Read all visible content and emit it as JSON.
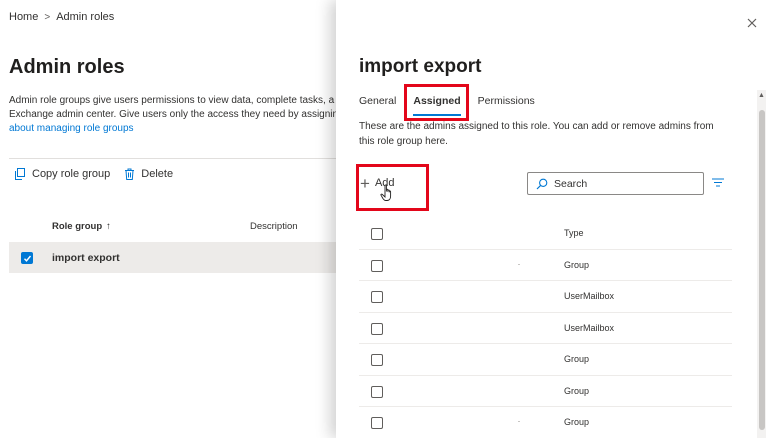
{
  "breadcrumb": {
    "home": "Home",
    "separator": ">",
    "current": "Admin roles"
  },
  "page": {
    "title": "Admin roles",
    "description_line1": "Admin role groups give users permissions to view data, complete tasks, a",
    "description_line2": "Exchange admin center. Give users only the access they need by assignin",
    "description_link": "about managing role groups"
  },
  "commands": {
    "copy": "Copy role group",
    "delete": "Delete"
  },
  "list": {
    "col_role": "Role group",
    "sort_indicator": "↑",
    "col_description": "Description",
    "selected_row": "import export"
  },
  "panel": {
    "title": "import export",
    "tabs": [
      {
        "label": "General"
      },
      {
        "label": "Assigned"
      },
      {
        "label": "Permissions"
      }
    ],
    "active_tab": "Assigned",
    "description": "These are the admins assigned to this role. You can add or remove admins from this role group here.",
    "add_label": "Add",
    "search_placeholder": "Search",
    "rows": [
      {
        "type": "Type"
      },
      {
        "type": "Group"
      },
      {
        "type": "UserMailbox"
      },
      {
        "type": "UserMailbox"
      },
      {
        "type": "Group"
      },
      {
        "type": "Group"
      },
      {
        "type": "Group"
      }
    ]
  },
  "colors": {
    "accent": "#0078d4",
    "highlight": "#e3061a",
    "selected_row": "#edebe9"
  },
  "icons": {
    "close": "close-icon",
    "copy": "copy-icon",
    "delete": "trash-icon",
    "add": "plus-icon",
    "search": "search-icon",
    "filter": "filter-icon",
    "check": "checkmark-icon"
  }
}
